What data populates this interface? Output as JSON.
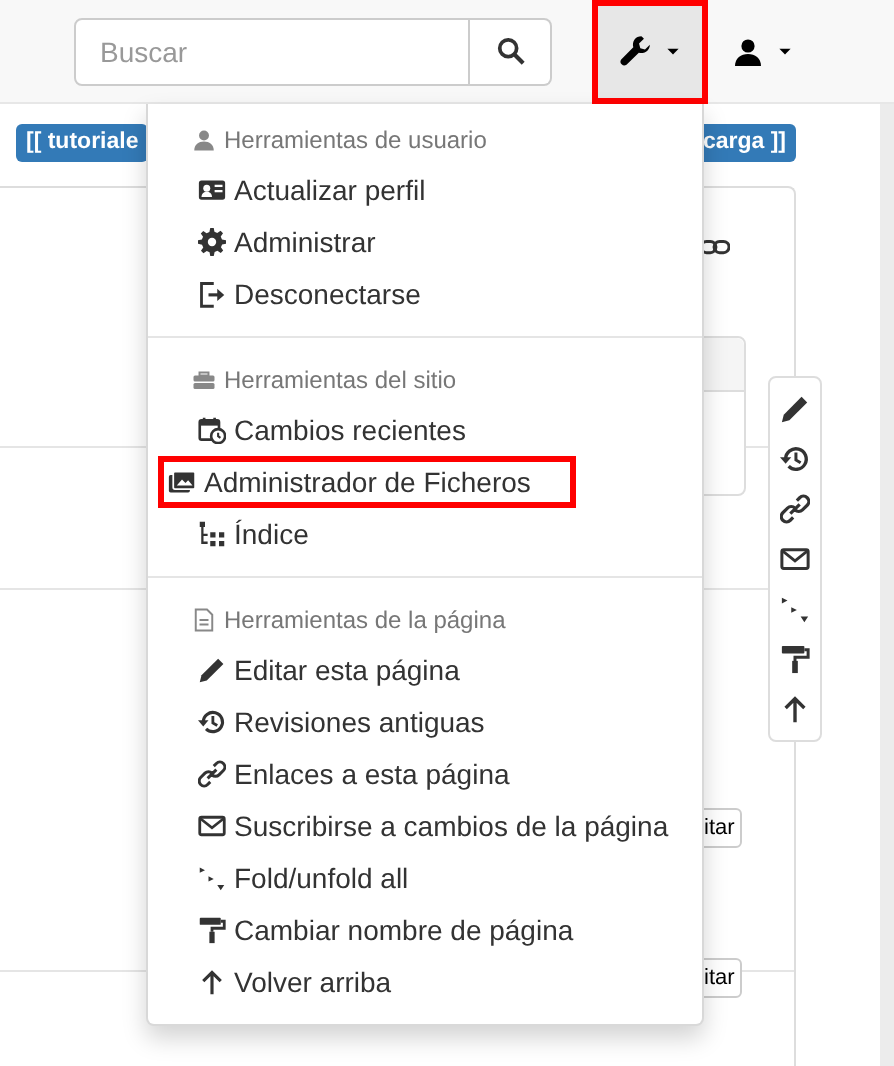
{
  "navbar": {
    "search": {
      "placeholder": "Buscar"
    },
    "tools_button": {
      "expanded": true,
      "highlighted": true
    }
  },
  "badges": [
    "[[ tutoriale",
    "carga ]]"
  ],
  "edit_buttons": [
    "itar",
    "itar"
  ],
  "menu": {
    "sections": [
      {
        "header": "Herramientas de usuario",
        "items": [
          {
            "label": "Actualizar perfil",
            "highlighted": false
          },
          {
            "label": "Administrar",
            "highlighted": false
          },
          {
            "label": "Desconectarse",
            "highlighted": false
          }
        ]
      },
      {
        "header": "Herramientas del sitio",
        "items": [
          {
            "label": "Cambios recientes",
            "highlighted": false
          },
          {
            "label": "Administrador de Ficheros",
            "highlighted": true
          },
          {
            "label": "Índice",
            "highlighted": false
          }
        ]
      },
      {
        "header": "Herramientas de la página",
        "items": [
          {
            "label": "Editar esta página",
            "highlighted": false
          },
          {
            "label": "Revisiones antiguas",
            "highlighted": false
          },
          {
            "label": "Enlaces a esta página",
            "highlighted": false
          },
          {
            "label": "Suscribirse a cambios de la página",
            "highlighted": false
          },
          {
            "label": "Fold/unfold all",
            "highlighted": false
          },
          {
            "label": "Cambiar nombre de página",
            "highlighted": false
          },
          {
            "label": "Volver arriba",
            "highlighted": false
          }
        ]
      }
    ]
  }
}
